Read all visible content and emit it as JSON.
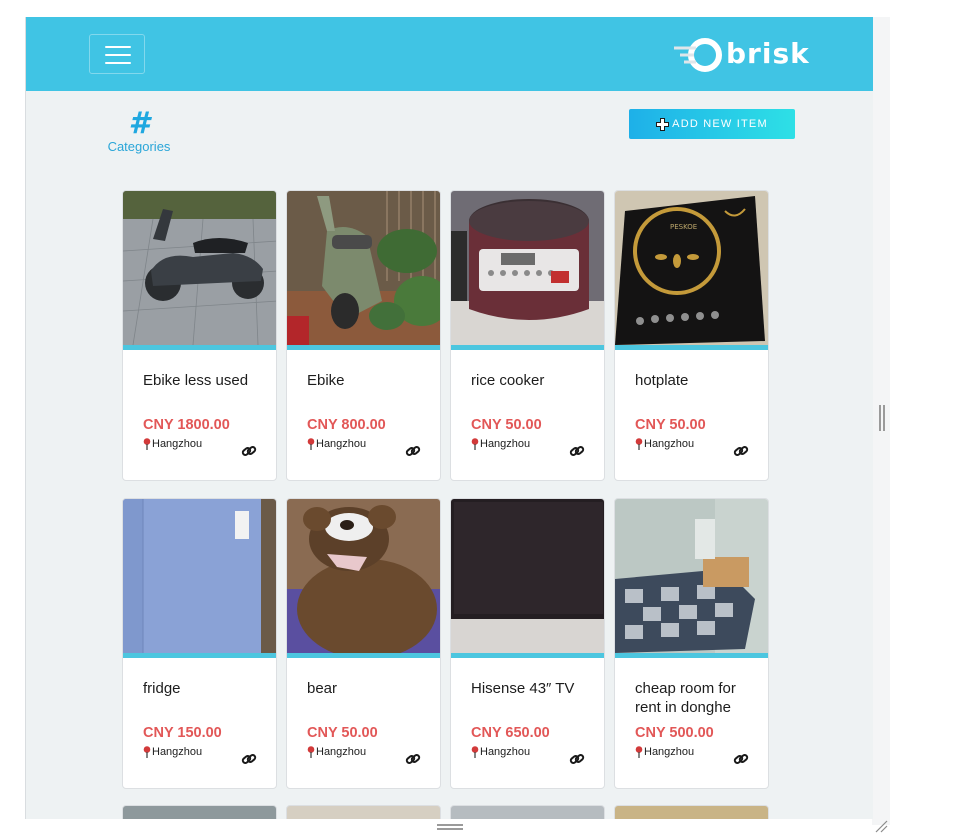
{
  "header": {
    "menu_icon": "hamburger-icon",
    "logo_text": "brisk",
    "brand_color": "#40c4e4"
  },
  "toolbar": {
    "categories_icon": "#",
    "categories_label": "Categories",
    "add_button_label": "ADD NEW ITEM"
  },
  "listings": [
    {
      "title": "Ebike less used",
      "price": "CNY 1800.00",
      "location": "Hangzhou",
      "photo": "scooter-photo"
    },
    {
      "title": "Ebike",
      "price": "CNY 800.00",
      "location": "Hangzhou",
      "photo": "green-scooter-photo"
    },
    {
      "title": "rice cooker",
      "price": "CNY 50.00",
      "location": "Hangzhou",
      "photo": "rice-cooker-photo"
    },
    {
      "title": "hotplate",
      "price": "CNY 50.00",
      "location": "Hangzhou",
      "photo": "hotplate-photo"
    },
    {
      "title": "fridge",
      "price": "CNY 150.00",
      "location": "Hangzhou",
      "photo": "fridge-photo"
    },
    {
      "title": "bear",
      "price": "CNY 50.00",
      "location": "Hangzhou",
      "photo": "teddy-bear-photo"
    },
    {
      "title": "Hisense 43″ TV",
      "price": "CNY 650.00",
      "location": "Hangzhou",
      "photo": "tv-photo"
    },
    {
      "title": "cheap room for rent in donghe",
      "price": "CNY 500.00",
      "location": "Hangzhou",
      "photo": "room-photo"
    }
  ],
  "colors": {
    "price": "#e25757",
    "accent": "#4cc6df",
    "background": "#eef2f3"
  }
}
